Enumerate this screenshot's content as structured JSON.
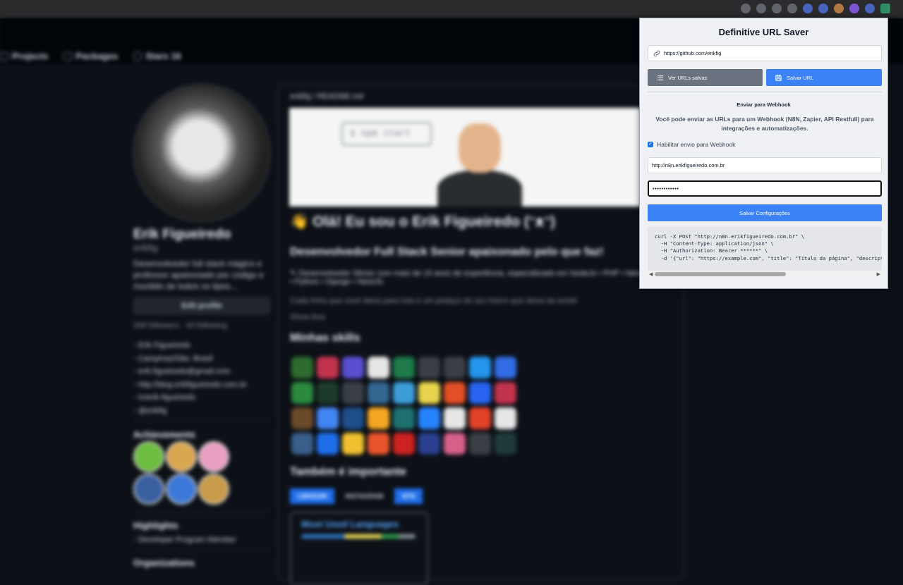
{
  "background": {
    "nav_tabs": [
      "Projects",
      "Packages",
      "Stars 16"
    ],
    "profile": {
      "name": "Erik Figueiredo",
      "login": "erikfig",
      "bio": "Desenvolvedor full stack mágico e professor apaixonado por código e mordido de todos os tipos...",
      "edit_button": "Edit profile",
      "followers": "268 followers · 40 following",
      "details": [
        "Erik Figueiredo",
        "Campinas/São, Brasil",
        "erik.figueiredo@gmail.com",
        "http://blog.erikfigueiredo.com.br",
        "in/erik-figueiredo",
        "@erikfig"
      ],
      "achievements_title": "Achievements",
      "highlights_title": "Highlights",
      "highlight_item": "Developer Program Member",
      "organizations_title": "Organizations"
    },
    "readme": {
      "path": "erikfig / README.md",
      "banner_code": "$ npm start",
      "heading": "👋 Olá! Eu sou o Erik Figueiredo (ᵔᴥᵔ)",
      "subheading": "Desenvolvedor Full Stack Senior apaixonado pelo que faz!",
      "intro": "✎ Desenvolvedor Sênior com mais de 15 anos de experiência, especializado em NodeJs • PHP • Nest • React • Python • Django • NestJS.",
      "quote": "Cada linha que você deixa para trás é um pedaço do seu futuro que deixa de existir",
      "show_more": "Show less",
      "skills_title": "Minhas skills",
      "important_title": "Também é importante",
      "pills": [
        "LINKEDIN",
        "INSTAGRAM",
        "SITE"
      ],
      "languages_title": "Most Used Languages"
    }
  },
  "popup": {
    "title": "Definitive URL Saver",
    "url_value": "https://github.com/erikfig",
    "icons": {
      "url": "link-icon",
      "list": "list-icon",
      "save": "save-icon"
    },
    "buttons": {
      "view_saved": "Ver URLs salvas",
      "save_url": "Salvar URL",
      "save_config": "Salvar Configurações"
    },
    "webhook": {
      "section_title": "Enviar para Webhook",
      "description": "Você pode enviar as URLs para um Webhook (N8N, Zapier, API Restfull) para integrações e automatizações.",
      "enable_label": "Habilitar envio para Webhook",
      "enabled": true,
      "url_value": "http://n8n.erikfigueiredo.com.br",
      "token_value": "••••••••••••"
    },
    "curl_example": "curl -X POST \"http://n8n.erikfigueiredo.com.br\" \\\n  -H \"Content-Type: application/json\" \\\n  -H \"Authorization: Bearer ******\" \\\n  -d '{\"url\": \"https://example.com\", \"title\": \"Título da página\", \"description\": \"Descrição da página\"}'"
  },
  "colors": {
    "primary": "#3b82f6",
    "secondary": "#6b7280",
    "popup_bg": "#eff1f5",
    "page_bg": "#0d1117"
  }
}
